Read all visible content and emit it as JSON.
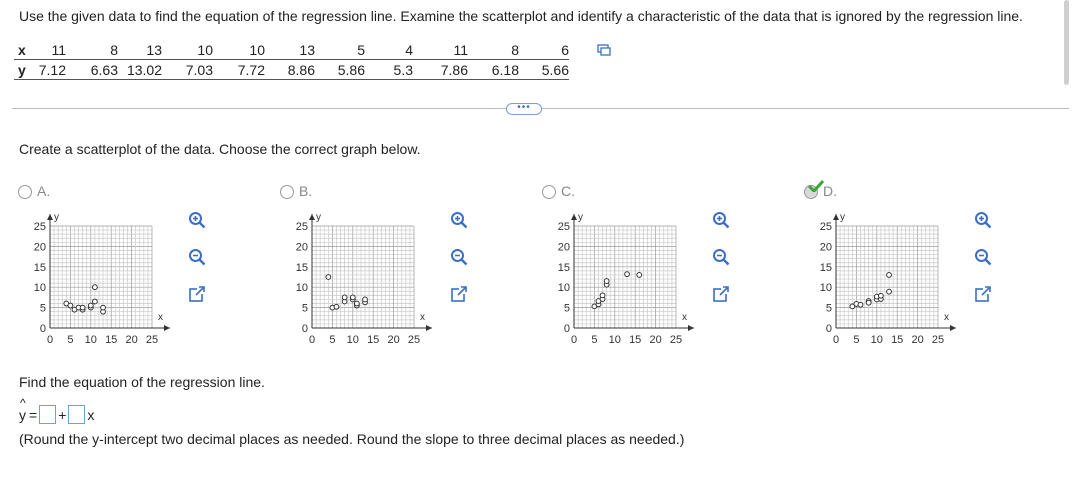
{
  "instruction": "Use the given data to find the equation of the regression line. Examine the scatterplot and identify a characteristic of the data that is ignored by the regression line.",
  "table": {
    "x_label": "x",
    "y_label": "y",
    "x": [
      "11",
      "8",
      "13",
      "10",
      "10",
      "13",
      "5",
      "4",
      "11",
      "8",
      "6"
    ],
    "y": [
      "7.12",
      "6.63",
      "13.02",
      "7.03",
      "7.72",
      "8.86",
      "5.86",
      "5.3",
      "7.86",
      "6.18",
      "5.66"
    ]
  },
  "more_button": "•••",
  "prompt": "Create a scatterplot of the data. Choose the correct graph below.",
  "options": [
    {
      "label": "A.",
      "selected": false,
      "points": [
        [
          4,
          6
        ],
        [
          5,
          5.5
        ],
        [
          6,
          4.5
        ],
        [
          7,
          5
        ],
        [
          8,
          4.5
        ],
        [
          8,
          5
        ],
        [
          10,
          5
        ],
        [
          10,
          5.5
        ],
        [
          11,
          6.5
        ],
        [
          11,
          10
        ],
        [
          13,
          4
        ],
        [
          13,
          5
        ]
      ]
    },
    {
      "label": "B.",
      "selected": false,
      "points": [
        [
          4,
          12.5
        ],
        [
          5,
          5
        ],
        [
          6,
          5.2
        ],
        [
          8,
          6.5
        ],
        [
          8,
          7.5
        ],
        [
          10,
          7
        ],
        [
          10,
          7.5
        ],
        [
          11,
          5.5
        ],
        [
          11,
          6
        ],
        [
          13,
          6.3
        ],
        [
          13,
          7
        ]
      ]
    },
    {
      "label": "C.",
      "selected": false,
      "points": [
        [
          5,
          5.3
        ],
        [
          6,
          5.8
        ],
        [
          6,
          6.6
        ],
        [
          7,
          7.1
        ],
        [
          7,
          8
        ],
        [
          8,
          10.6
        ],
        [
          8,
          11.5
        ],
        [
          13,
          13.2
        ],
        [
          16,
          13
        ]
      ]
    },
    {
      "label": "D.",
      "selected": true,
      "points": [
        [
          4,
          5.3
        ],
        [
          5,
          5.9
        ],
        [
          6,
          5.7
        ],
        [
          8,
          6.6
        ],
        [
          8,
          6.2
        ],
        [
          10,
          7.0
        ],
        [
          10,
          7.7
        ],
        [
          11,
          7.1
        ],
        [
          11,
          7.9
        ],
        [
          13,
          8.9
        ],
        [
          13,
          13.0
        ]
      ]
    }
  ],
  "axes": {
    "x_ticks": [
      "0",
      "5",
      "10",
      "15",
      "20",
      "25"
    ],
    "y_ticks": [
      "25",
      "20",
      "15",
      "10",
      "5",
      "0"
    ],
    "x_label": "x",
    "y_label": "y"
  },
  "find": "Find the equation of the regression line.",
  "equation": {
    "y_symbol": "y",
    "hat": "^",
    "eq": "=",
    "plus": "+",
    "x_symbol": "x"
  },
  "hint": "(Round the y-intercept two decimal places as needed. Round the slope to three decimal places as needed.)",
  "colors": {
    "accent": "#3a6fc4",
    "check": "#3aa63a"
  }
}
